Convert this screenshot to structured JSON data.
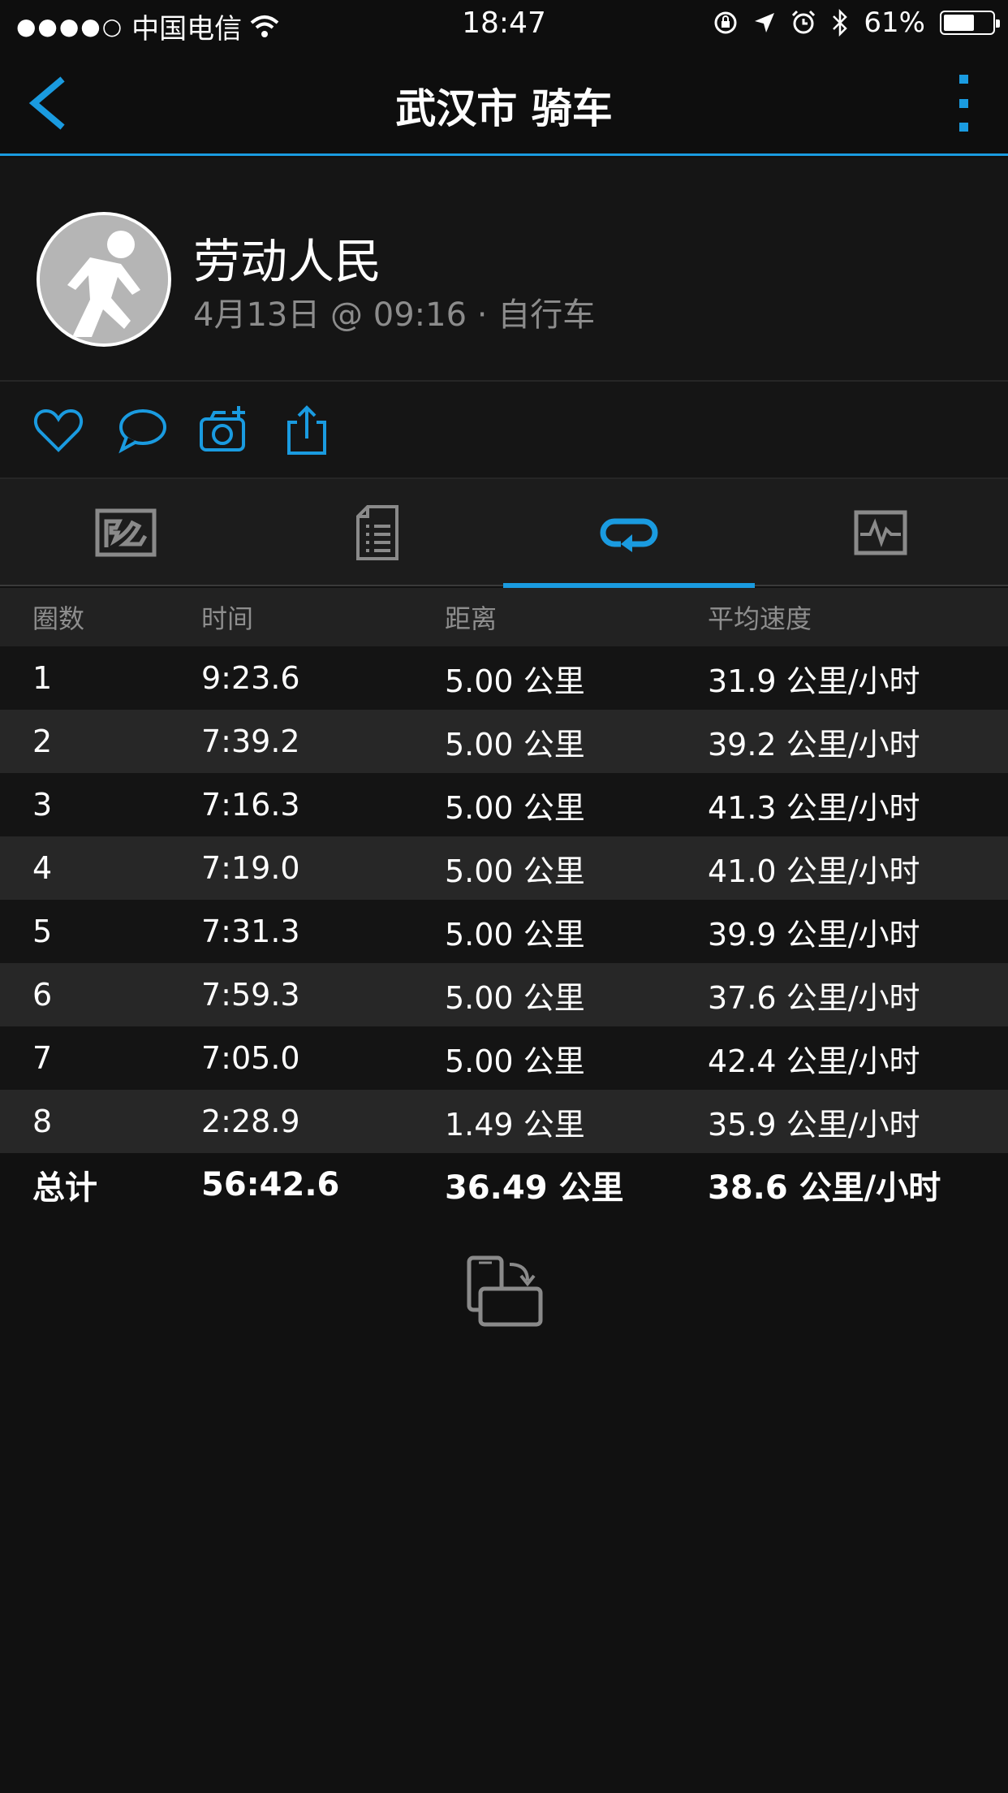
{
  "status_bar": {
    "carrier": "中国电信",
    "signal_dots": "●●●●○",
    "time": "18:47",
    "battery": "61%",
    "battery_level": 0.61
  },
  "nav": {
    "title": "武汉市 骑车"
  },
  "profile": {
    "name": "劳动人民",
    "meta": "4月13日 @ 09:16 · 自行车"
  },
  "actions": [
    "heart-icon",
    "comment-icon",
    "camera-add-icon",
    "share-icon"
  ],
  "tabs": [
    {
      "icon": "map-icon",
      "active": false
    },
    {
      "icon": "summary-document-icon",
      "active": false
    },
    {
      "icon": "laps-loop-icon",
      "active": true
    },
    {
      "icon": "chart-icon",
      "active": false
    }
  ],
  "laps": {
    "headers": [
      "圈数",
      "时间",
      "距离",
      "平均速度"
    ],
    "rows": [
      [
        "1",
        "9:23.6",
        "5.00 公里",
        "31.9 公里/小时"
      ],
      [
        "2",
        "7:39.2",
        "5.00 公里",
        "39.2 公里/小时"
      ],
      [
        "3",
        "7:16.3",
        "5.00 公里",
        "41.3 公里/小时"
      ],
      [
        "4",
        "7:19.0",
        "5.00 公里",
        "41.0 公里/小时"
      ],
      [
        "5",
        "7:31.3",
        "5.00 公里",
        "39.9 公里/小时"
      ],
      [
        "6",
        "7:59.3",
        "5.00 公里",
        "37.6 公里/小时"
      ],
      [
        "7",
        "7:05.0",
        "5.00 公里",
        "42.4 公里/小时"
      ],
      [
        "8",
        "2:28.9",
        "1.49 公里",
        "35.9 公里/小时"
      ]
    ],
    "total": [
      "总计",
      "56:42.6",
      "36.49 公里",
      "38.6 公里/小时"
    ]
  },
  "colors": {
    "accent": "#1a9be0",
    "background": "#111111"
  }
}
